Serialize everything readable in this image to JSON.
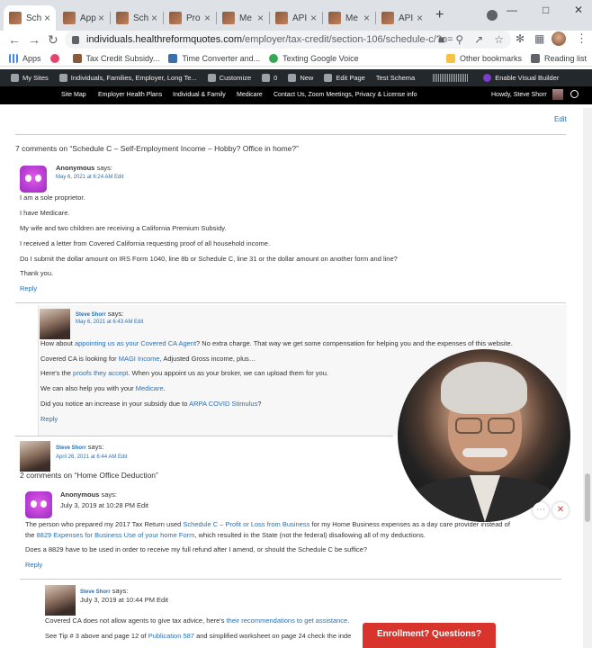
{
  "browser": {
    "tabs": [
      {
        "label": "Sch"
      },
      {
        "label": "App"
      },
      {
        "label": "Sch"
      },
      {
        "label": "Pro"
      },
      {
        "label": "Me"
      },
      {
        "label": "API"
      },
      {
        "label": "Me"
      },
      {
        "label": "API"
      }
    ],
    "new_tab": "+",
    "url_main": "individuals.healthreformquotes.com",
    "url_path": "/employer/tax-credit/section-106/schedule-c/?o=bG...",
    "bookmarks": [
      {
        "label": "Apps"
      },
      {
        "label": ""
      },
      {
        "label": "Tax Credit Subsidy..."
      },
      {
        "label": "Time Converter and..."
      },
      {
        "label": "Texting Google Voice"
      }
    ],
    "other_bookmarks": "Other bookmarks",
    "reading_list": "Reading list"
  },
  "wp_admin": {
    "items": [
      "My Sites",
      "Individuals, Families, Employer, Long Te...",
      "Customize",
      "0",
      "New",
      "Edit Page",
      "Test Schema"
    ],
    "visual_builder": "Enable Visual Builder"
  },
  "site_nav": {
    "items": [
      "Site Map",
      "Employer Health Plans",
      "Individual & Family",
      "Medicare",
      "Contact Us, Zoom Meetings, Privacy & License info"
    ],
    "howdy": "Howdy, Steve Shorr"
  },
  "page": {
    "edit": "Edit",
    "thread1_title": "7 comments on “Schedule C – Self-Employment Income – Hobby? Office in home?”",
    "c1": {
      "author": "Anonymous",
      "says": "says:",
      "date": "May 6, 2021 at 6:24 AM Edit",
      "lines": [
        "I am a sole proprietor.",
        "I have Medicare.",
        "My wife and two children are receiving a California Premium Subsidy.",
        "I received a letter from Covered California requesting proof of all household income.",
        "Do I submit the dollar amount on IRS Form 1040, line 8b or Schedule C, line 31 or the dollar amount on another form and line?",
        "Thank you."
      ],
      "reply": "Reply"
    },
    "c2": {
      "author": "Steve Shorr",
      "says": "says:",
      "date": "May 6, 2021 at 6:43 AM Edit",
      "l1a": "How about ",
      "l1link": "appointing us as your Covered CA Agent",
      "l1b": "? No extra charge. That way we get some compensation for helping you and the expenses of this website.",
      "l2a": "Covered CA is looking for ",
      "l2link": "MAGI Income",
      "l2b": ", Adjusted Gross income, plus…",
      "l3a": "Here's the ",
      "l3link": "proofs they accept",
      "l3b": ". When you appoint us as your broker, we can upload them for you.",
      "l4a": "We can also help you with your ",
      "l4link": "Medicare",
      "l4b": ".",
      "l5a": "Did you notice an increase in your subsidy due to ",
      "l5link": "ARPA COVID Stimulus",
      "l5b": "?",
      "reply": "Reply"
    },
    "c3": {
      "author": "Steve Shorr",
      "says": "says:",
      "date": "April 26, 2021 at 6:44 AM Edit"
    },
    "thread2_title": "2 comments on “Home Office Deduction”",
    "c4": {
      "author": "Anonymous",
      "says": "says:",
      "date": "July 3, 2019 at 10:28 PM Edit",
      "l1a": "The person who prepared my 2017 Tax Return used ",
      "l1link": "Schedule C – Profit or Loss from Business",
      "l1b": " for my Home Business expenses as a day care provider instead of",
      "l2a": "the ",
      "l2link": "8829 Expenses for Business Use of your home Form",
      "l2b": ", which resulted in the State (not the federal) disallowing all of my deductions.",
      "l3": "Does a 8829 have to be used in order to receive my full refund after I amend, or should the Schedule C be suffice?",
      "reply": "Reply"
    },
    "c5": {
      "author": "Steve Shorr",
      "says": "says:",
      "date": "July 3, 2019 at 10:44 PM Edit",
      "l1a": "Covered CA does not allow agents to give tax advice, here's ",
      "l1link": "their recommendations to get assistance",
      "l1b": ".",
      "l2a": "See Tip # 3 above and page 12 of ",
      "l2link": "Publication 587",
      "l2b": " and simplified worksheet on page 24 check the inde"
    },
    "enroll_button": "Enrollment? Questions?"
  }
}
